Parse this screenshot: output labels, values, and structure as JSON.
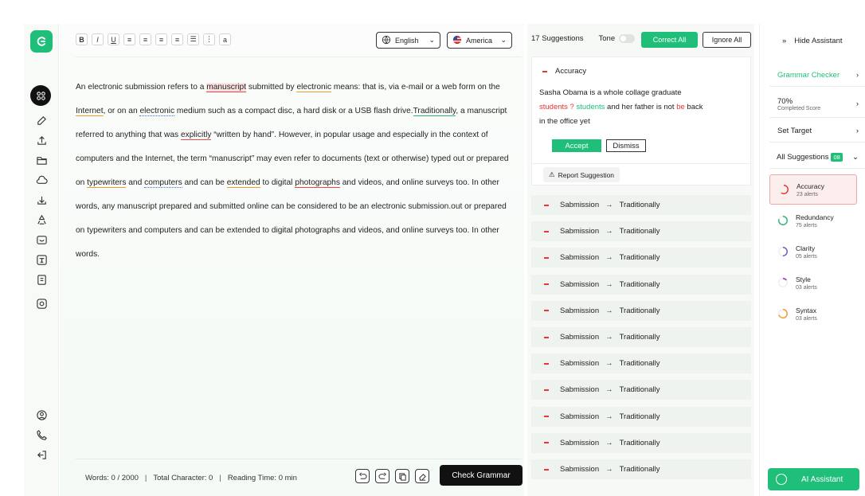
{
  "editor": {
    "language": "English",
    "region": "America",
    "paragraph": [
      {
        "t": "An electronic submission refers to a "
      },
      {
        "t": "manuscript",
        "c": "u-red hl"
      },
      {
        "t": " submitted by "
      },
      {
        "t": "electronic",
        "c": "u-org"
      },
      {
        "t": " means: that is, via e-mail or a web form on the "
      },
      {
        "t": "Internet",
        "c": "u-org"
      },
      {
        "t": ", or on an "
      },
      {
        "t": "electronic",
        "c": "u-blu"
      },
      {
        "t": " medium such as a compact disc, a hard disk or a USB flash drive."
      },
      {
        "t": "Traditionally",
        "c": "u-grn"
      },
      {
        "t": ", a manuscript referred to anything that was "
      },
      {
        "t": "explicitly",
        "c": "u-red"
      },
      {
        "t": " “written by hand”. However, in popular usage and especially in the context of computers and the Internet, the term “manuscript” may even refer to documents (text or otherwise) typed out or prepared on "
      },
      {
        "t": "typewriters",
        "c": "u-org"
      },
      {
        "t": " and "
      },
      {
        "t": "computers",
        "c": "u-blu"
      },
      {
        "t": " and can be "
      },
      {
        "t": "extended",
        "c": "u-org"
      },
      {
        "t": " to digital "
      },
      {
        "t": "photographs",
        "c": "u-red"
      },
      {
        "t": " and videos, and online surveys too. In other words, any manuscript prepared and submitted online can be considered to be an electronic submission.out or prepared on typewriters and computers and can be extended to digital photographs and videos, and online surveys too. In other words."
      }
    ],
    "words": "Words: 0 / 2000",
    "chars": "Total Character: 0",
    "reading": "Reading Time: 0 min",
    "check_label": "Check Grammar"
  },
  "suggestions": {
    "count": "17 Suggestions",
    "tone": "Tone",
    "correct_all": "Correct All",
    "ignore_all": "Ignore All",
    "card": {
      "title": "Accuracy",
      "line1": "Sasha Obama is a whole collage graduate",
      "wrong": "students ?",
      "right": "students",
      "mid": " and her father is not ",
      "be": "be",
      "back": " back",
      "line3": "in the office yet",
      "accept": "Accept",
      "dismiss": "Dismiss",
      "report": "Report Suggestion"
    },
    "rows": [
      {
        "from": "Sabmission",
        "arrow": "→",
        "to": "Traditionally"
      },
      {
        "from": "Sabmission",
        "arrow": "→",
        "to": "Traditionally"
      },
      {
        "from": "Sabmission",
        "arrow": "→",
        "to": "Traditionally"
      },
      {
        "from": "Sabmission",
        "arrow": "→",
        "to": "Traditionally"
      },
      {
        "from": "Sabmission",
        "arrow": "→",
        "to": "Traditionally"
      },
      {
        "from": "Sabmission",
        "arrow": "→",
        "to": "Traditionally"
      },
      {
        "from": "Sabmission",
        "arrow": "→",
        "to": "Traditionally"
      },
      {
        "from": "Sabmission",
        "arrow": "→",
        "to": "Traditionally"
      },
      {
        "from": "Sabmission",
        "arrow": "→",
        "to": "Traditionally"
      },
      {
        "from": "Sabmission",
        "arrow": "→",
        "to": "Traditionally"
      },
      {
        "from": "Sabmission",
        "arrow": "→",
        "to": "Traditionally"
      }
    ]
  },
  "panel": {
    "hide": "Hide Assistant",
    "grammar_checker": "Grammar Checker",
    "score": "70%",
    "score_sub": "Completed Score",
    "set_target": "Set Target",
    "all_suggestions": "All Suggestions",
    "all_count": "08",
    "categories": [
      {
        "name": "Accuracy",
        "alerts": "23 alerts",
        "color": "#e33",
        "level": 0.6
      },
      {
        "name": "Redundancy",
        "alerts": "75 alerts",
        "color": "#2bb673",
        "level": 0.8
      },
      {
        "name": "Clarity",
        "alerts": "05 alerts",
        "color": "#6a5acd",
        "level": 0.5
      },
      {
        "name": "Style",
        "alerts": "03 alerts",
        "color": "#8a3ab9",
        "level": 0.15
      },
      {
        "name": "Syntax",
        "alerts": "03 alerts",
        "color": "#f29a2e",
        "level": 0.7
      }
    ],
    "ai_label": "AI Assistant"
  },
  "colors": {
    "brand": "#1fbf7a",
    "error": "#e33"
  }
}
